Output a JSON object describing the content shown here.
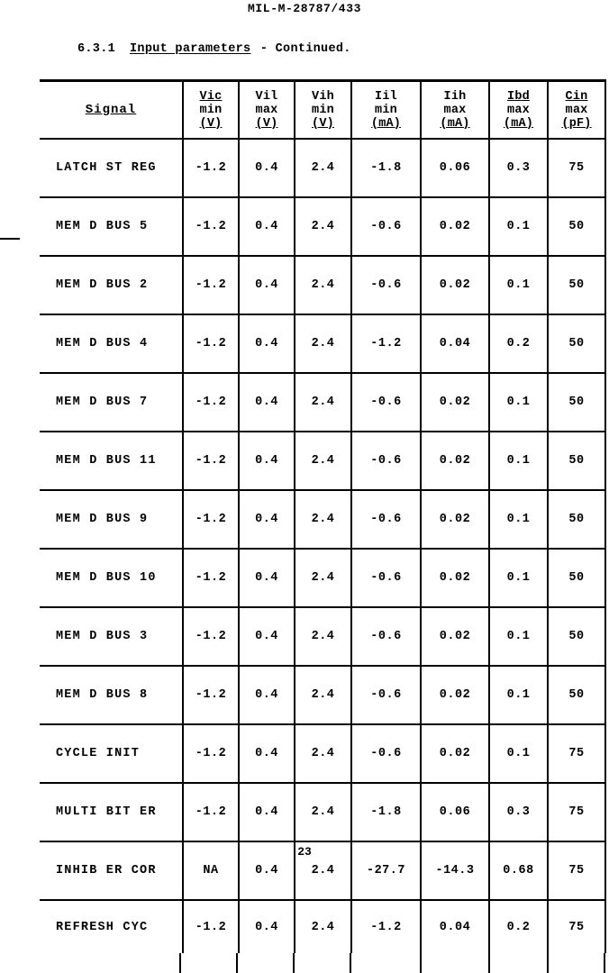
{
  "document": {
    "spec_number": "MIL-M-28787/433",
    "page_number": "23"
  },
  "section": {
    "number": "6.3.1",
    "title": "Input parameters",
    "continued": "- Continued."
  },
  "table": {
    "columns": [
      {
        "name": "Signal",
        "line1": "Signal",
        "line2": "",
        "line3": ""
      },
      {
        "name": "Vic min",
        "line1": "Vic",
        "line2": "min",
        "line3": "(V)"
      },
      {
        "name": "Vil max",
        "line1": "Vil",
        "line2": "max",
        "line3": "(V)"
      },
      {
        "name": "Vih min",
        "line1": "Vih",
        "line2": "min",
        "line3": "(V)"
      },
      {
        "name": "Iil min",
        "line1": "Iil",
        "line2": "min",
        "line3": "(mA)"
      },
      {
        "name": "Iih max",
        "line1": "Iih",
        "line2": "max",
        "line3": "(mA)"
      },
      {
        "name": "Ibd max",
        "line1": "Ibd",
        "line2": "max",
        "line3": "(mA)"
      },
      {
        "name": "Cin max",
        "line1": "Cin",
        "line2": "max",
        "line3": "(pF)"
      }
    ],
    "rows": [
      {
        "signal": "LATCH ST REG",
        "vic_min": "-1.2",
        "vil_max": "0.4",
        "vih_min": "2.4",
        "iil_min": "-1.8",
        "iih_max": "0.06",
        "ibd_max": "0.3",
        "cin_max": "75"
      },
      {
        "signal": "MEM D BUS 5",
        "vic_min": "-1.2",
        "vil_max": "0.4",
        "vih_min": "2.4",
        "iil_min": "-0.6",
        "iih_max": "0.02",
        "ibd_max": "0.1",
        "cin_max": "50"
      },
      {
        "signal": "MEM D BUS 2",
        "vic_min": "-1.2",
        "vil_max": "0.4",
        "vih_min": "2.4",
        "iil_min": "-0.6",
        "iih_max": "0.02",
        "ibd_max": "0.1",
        "cin_max": "50"
      },
      {
        "signal": "MEM D BUS 4",
        "vic_min": "-1.2",
        "vil_max": "0.4",
        "vih_min": "2.4",
        "iil_min": "-1.2",
        "iih_max": "0.04",
        "ibd_max": "0.2",
        "cin_max": "50"
      },
      {
        "signal": "MEM D BUS 7",
        "vic_min": "-1.2",
        "vil_max": "0.4",
        "vih_min": "2.4",
        "iil_min": "-0.6",
        "iih_max": "0.02",
        "ibd_max": "0.1",
        "cin_max": "50"
      },
      {
        "signal": "MEM D BUS 11",
        "vic_min": "-1.2",
        "vil_max": "0.4",
        "vih_min": "2.4",
        "iil_min": "-0.6",
        "iih_max": "0.02",
        "ibd_max": "0.1",
        "cin_max": "50"
      },
      {
        "signal": "MEM D BUS 9",
        "vic_min": "-1.2",
        "vil_max": "0.4",
        "vih_min": "2.4",
        "iil_min": "-0.6",
        "iih_max": "0.02",
        "ibd_max": "0.1",
        "cin_max": "50"
      },
      {
        "signal": "MEM D BUS 10",
        "vic_min": "-1.2",
        "vil_max": "0.4",
        "vih_min": "2.4",
        "iil_min": "-0.6",
        "iih_max": "0.02",
        "ibd_max": "0.1",
        "cin_max": "50"
      },
      {
        "signal": "MEM D BUS 3",
        "vic_min": "-1.2",
        "vil_max": "0.4",
        "vih_min": "2.4",
        "iil_min": "-0.6",
        "iih_max": "0.02",
        "ibd_max": "0.1",
        "cin_max": "50"
      },
      {
        "signal": "MEM D BUS 8",
        "vic_min": "-1.2",
        "vil_max": "0.4",
        "vih_min": "2.4",
        "iil_min": "-0.6",
        "iih_max": "0.02",
        "ibd_max": "0.1",
        "cin_max": "50"
      },
      {
        "signal": "CYCLE INIT",
        "vic_min": "-1.2",
        "vil_max": "0.4",
        "vih_min": "2.4",
        "iil_min": "-0.6",
        "iih_max": "0.02",
        "ibd_max": "0.1",
        "cin_max": "75"
      },
      {
        "signal": "MULTI BIT ER",
        "vic_min": "-1.2",
        "vil_max": "0.4",
        "vih_min": "2.4",
        "iil_min": "-1.8",
        "iih_max": "0.06",
        "ibd_max": "0.3",
        "cin_max": "75"
      },
      {
        "signal": "INHIB ER COR",
        "vic_min": "NA",
        "vil_max": "0.4",
        "vih_min": "2.4",
        "iil_min": "-27.7",
        "iih_max": "-14.3",
        "ibd_max": "0.68",
        "cin_max": "75"
      },
      {
        "signal": "REFRESH CYC",
        "vic_min": "-1.2",
        "vil_max": "0.4",
        "vih_min": "2.4",
        "iil_min": "-1.2",
        "iih_max": "0.04",
        "ibd_max": "0.2",
        "cin_max": "75"
      }
    ]
  }
}
